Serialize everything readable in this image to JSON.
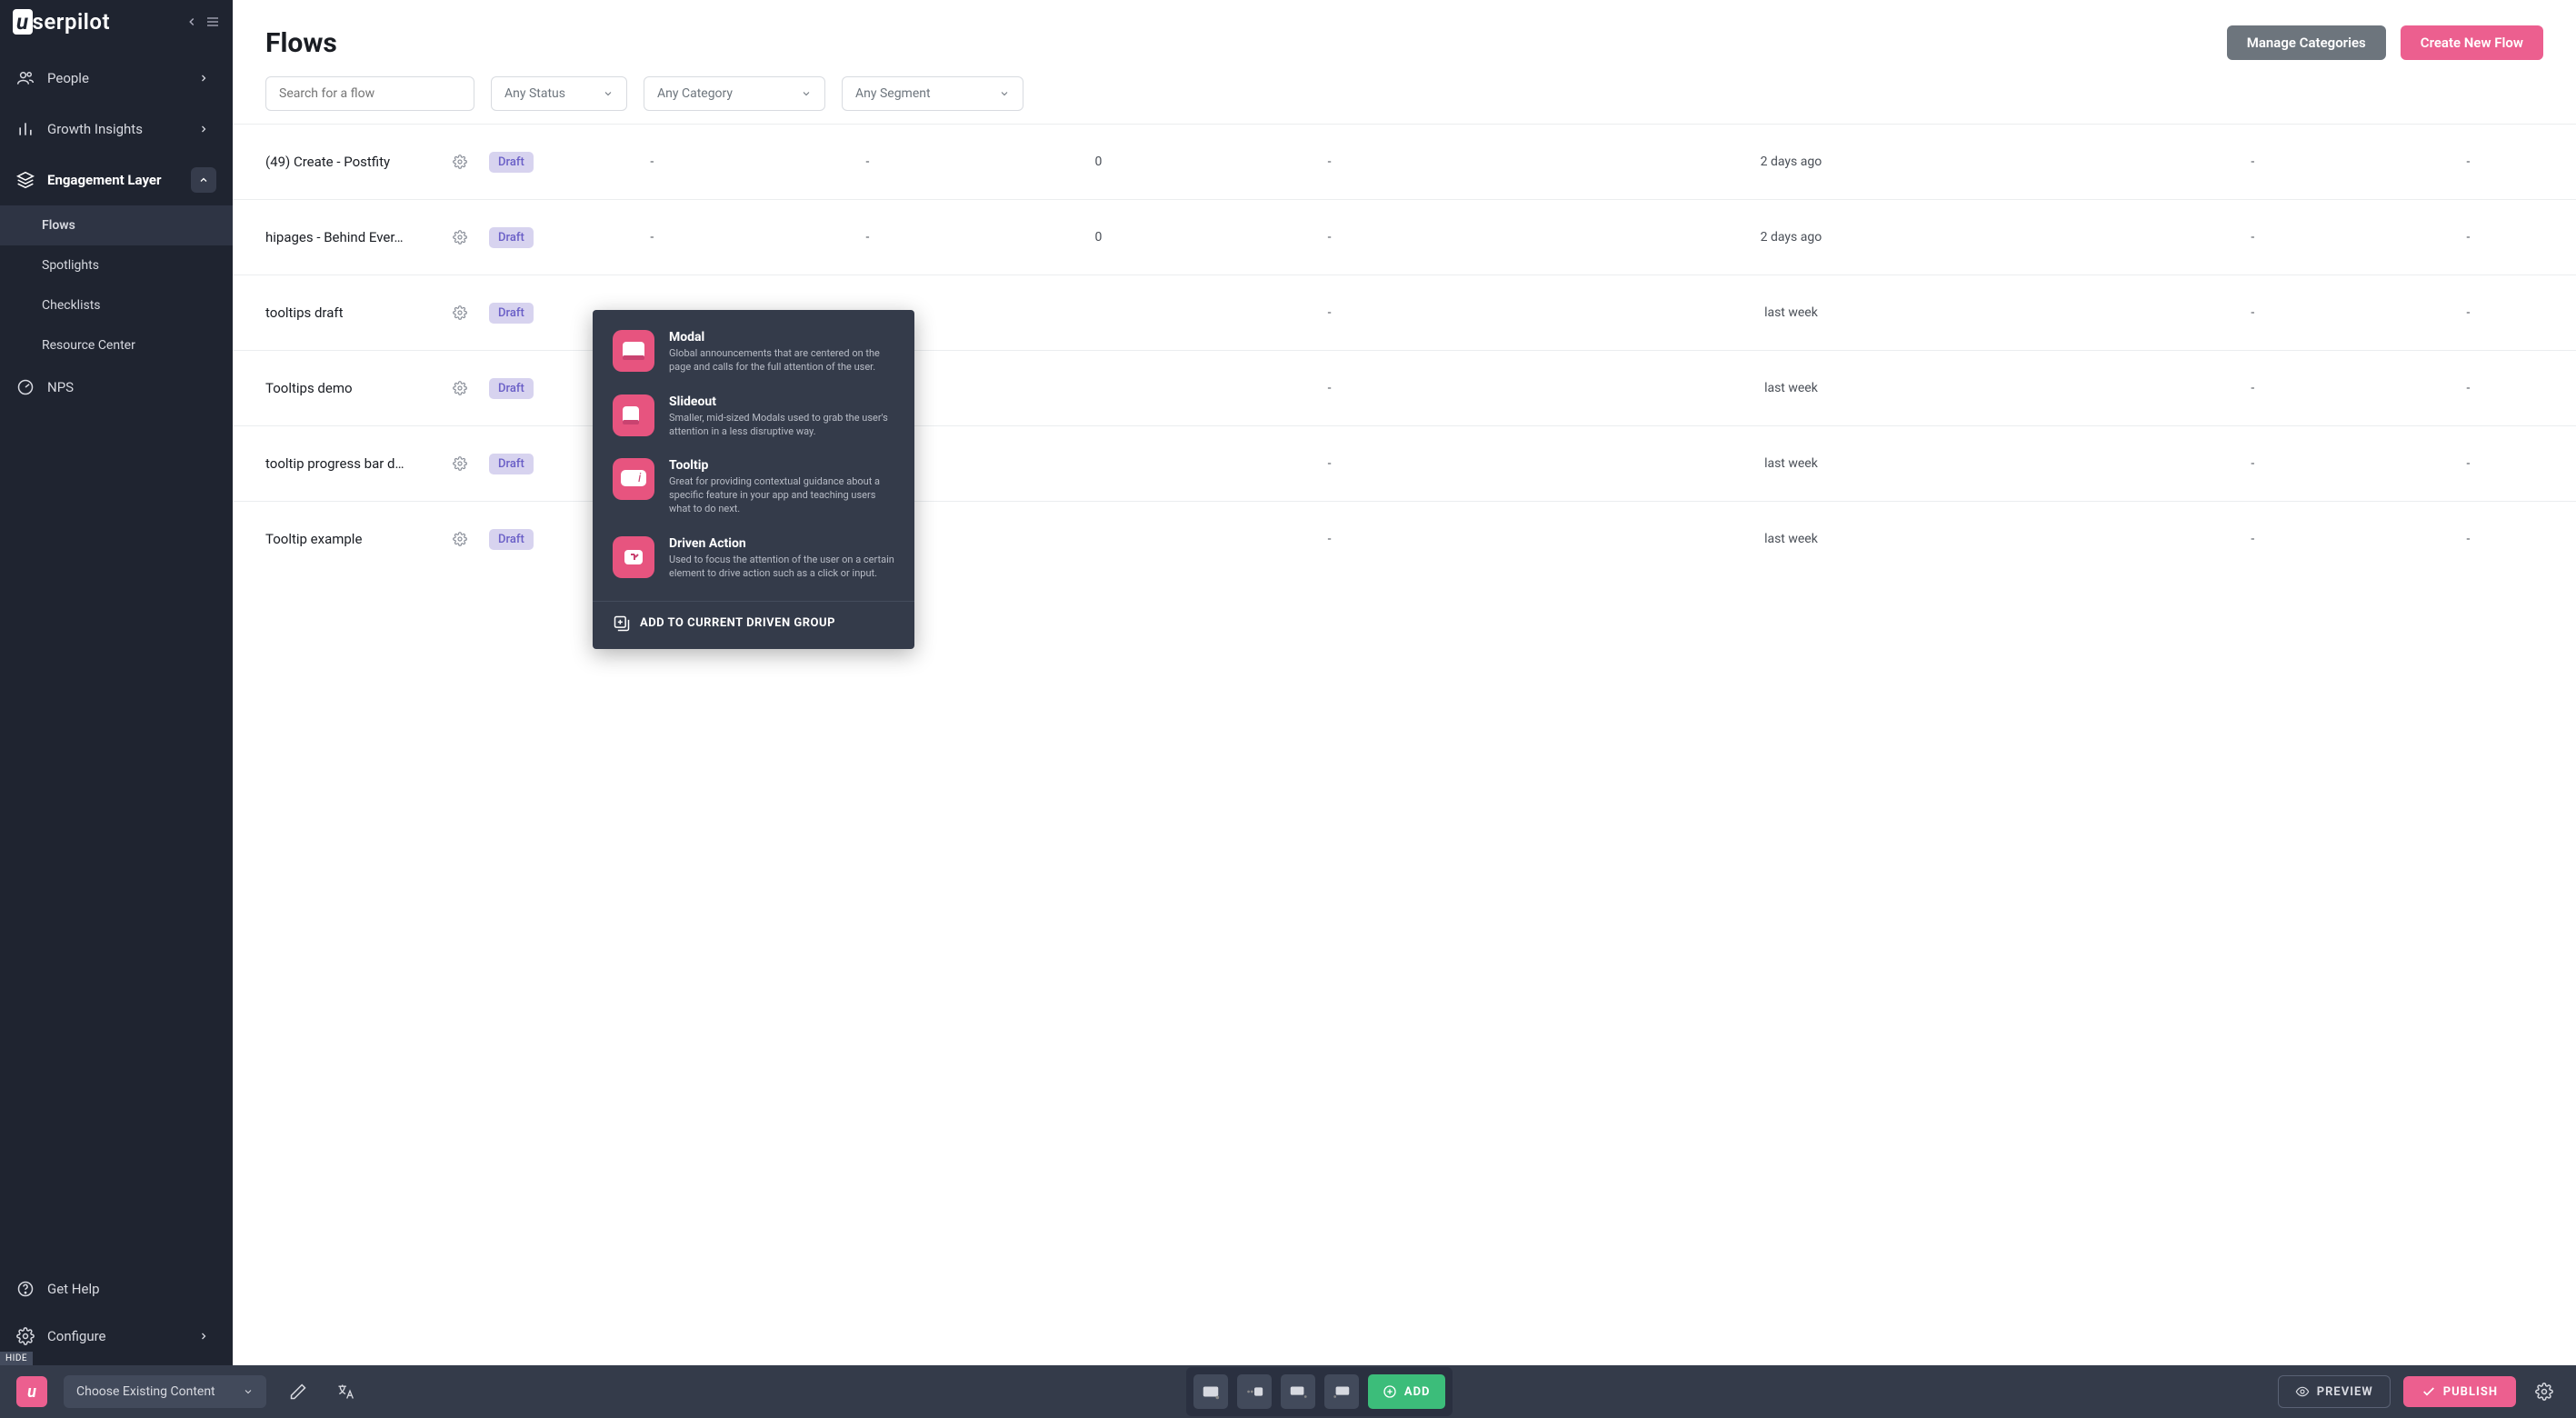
{
  "brand": "userpilot",
  "sidebar": {
    "items": [
      {
        "label": "People",
        "icon": "users",
        "expandable": true
      },
      {
        "label": "Growth Insights",
        "icon": "bars",
        "expandable": true
      },
      {
        "label": "Engagement Layer",
        "icon": "layers",
        "expandable": true,
        "open": true,
        "activeParent": true,
        "children": [
          {
            "label": "Flows",
            "active": true
          },
          {
            "label": "Spotlights"
          },
          {
            "label": "Checklists"
          },
          {
            "label": "Resource Center"
          }
        ]
      },
      {
        "label": "NPS",
        "icon": "gauge",
        "expandable": false
      }
    ],
    "footer": [
      {
        "label": "Get Help",
        "icon": "help"
      },
      {
        "label": "Configure",
        "icon": "gear",
        "expandable": true
      }
    ],
    "hide": "HIDE"
  },
  "header": {
    "title": "Flows",
    "manage": "Manage Categories",
    "create": "Create New Flow"
  },
  "filters": {
    "search_placeholder": "Search for a flow",
    "status": "Any Status",
    "category": "Any Category",
    "segment": "Any Segment"
  },
  "rows": [
    {
      "name": "(49) Create - Postfity",
      "status": "Draft",
      "c1": "-",
      "c2": "-",
      "c3": "0",
      "c4": "-",
      "c5": "2 days ago",
      "c6": "-",
      "c7": "-"
    },
    {
      "name": "hipages - Behind Ever…",
      "status": "Draft",
      "c1": "-",
      "c2": "-",
      "c3": "0",
      "c4": "-",
      "c5": "2 days ago",
      "c6": "-",
      "c7": "-"
    },
    {
      "name": "tooltips draft",
      "status": "Draft",
      "c1": "-",
      "c2": "",
      "c3": "",
      "c4": "-",
      "c5": "last week",
      "c6": "-",
      "c7": "-"
    },
    {
      "name": "Tooltips demo",
      "status": "Draft",
      "c1": "-",
      "c2": "",
      "c3": "",
      "c4": "-",
      "c5": "last week",
      "c6": "-",
      "c7": "-"
    },
    {
      "name": "tooltip progress bar d…",
      "status": "Draft",
      "c1": "-",
      "c2": "",
      "c3": "",
      "c4": "-",
      "c5": "last week",
      "c6": "-",
      "c7": "-"
    },
    {
      "name": "Tooltip example",
      "status": "Draft",
      "c1": "-",
      "c2": "",
      "c3": "",
      "c4": "-",
      "c5": "last week",
      "c6": "-",
      "c7": "-"
    }
  ],
  "popover": {
    "items": [
      {
        "title": "Modal",
        "desc": "Global announcements that are centered on the page and calls for the full attention of the user."
      },
      {
        "title": "Slideout",
        "desc": "Smaller, mid-sized Modals used to grab the user's attention in a less disruptive way."
      },
      {
        "title": "Tooltip",
        "desc": "Great for providing contextual guidance about a specific feature in your app and teaching users what to do next."
      },
      {
        "title": "Driven Action",
        "desc": "Used to focus the attention of the user on a certain element to drive action such as a click or input."
      }
    ],
    "footer": "ADD TO CURRENT DRIVEN GROUP"
  },
  "bottombar": {
    "content_drop": "Choose Existing Content",
    "add": "ADD",
    "preview": "PREVIEW",
    "publish": "PUBLISH"
  }
}
